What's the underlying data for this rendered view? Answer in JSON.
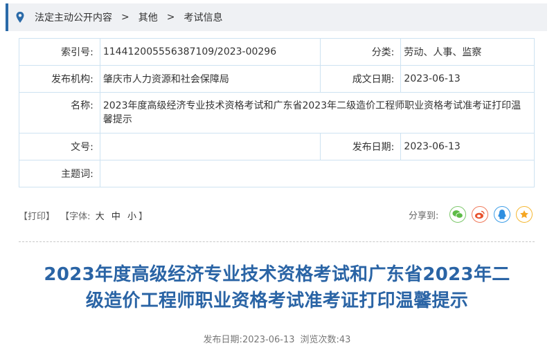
{
  "breadcrumb": {
    "icon": "location-pin-icon",
    "items": [
      "法定主动公开内容",
      "其他",
      "考试信息"
    ],
    "separator": ">"
  },
  "info": {
    "index_label": "索引号:",
    "index_value": "114412005556387109/2023-00296",
    "category_label": "分类:",
    "category_value": "劳动、人事、监察",
    "publisher_label": "发布机构:",
    "publisher_value": "肇庆市人力资源和社会保障局",
    "written_date_label": "成文日期:",
    "written_date_value": "2023-06-13",
    "name_label": "名称:",
    "name_value": "2023年度高级经济专业技术资格考试和广东省2023年二级造价工程师职业资格考试准考证打印温馨提示",
    "doc_no_label": "文号:",
    "doc_no_value": "",
    "publish_date_label": "发布日期:",
    "publish_date_value": "2023-06-13",
    "keywords_label": "主题词:",
    "keywords_value": ""
  },
  "tools": {
    "print": "【打印】",
    "font_prefix": "【字体:",
    "font_large": "大",
    "font_medium": "中",
    "font_small": "小",
    "font_suffix": "】"
  },
  "share": {
    "label": "分享到:",
    "targets": [
      {
        "name": "wechat",
        "icon": "wechat-icon",
        "color": "#7cc76a"
      },
      {
        "name": "weibo",
        "icon": "weibo-icon",
        "color": "#f0795a"
      },
      {
        "name": "qq",
        "icon": "qq-icon",
        "color": "#3d9ee8"
      },
      {
        "name": "qzone",
        "icon": "qzone-star-icon",
        "color": "#f5b731"
      }
    ]
  },
  "article": {
    "title_line1": "2023年度高级经济专业技术资格考试和广东省2023年二",
    "title_line2": "级造价工程师职业资格考试准考证打印温馨提示",
    "publish_label": "发布日期:",
    "publish_date": "2023-06-13",
    "views_label": "浏览次数:",
    "views": "43"
  },
  "colors": {
    "accent": "#2a6aa8",
    "title": "#2a64a5",
    "table_border": "#cde2f1",
    "breadcrumb_bg": "#eff1f4"
  }
}
